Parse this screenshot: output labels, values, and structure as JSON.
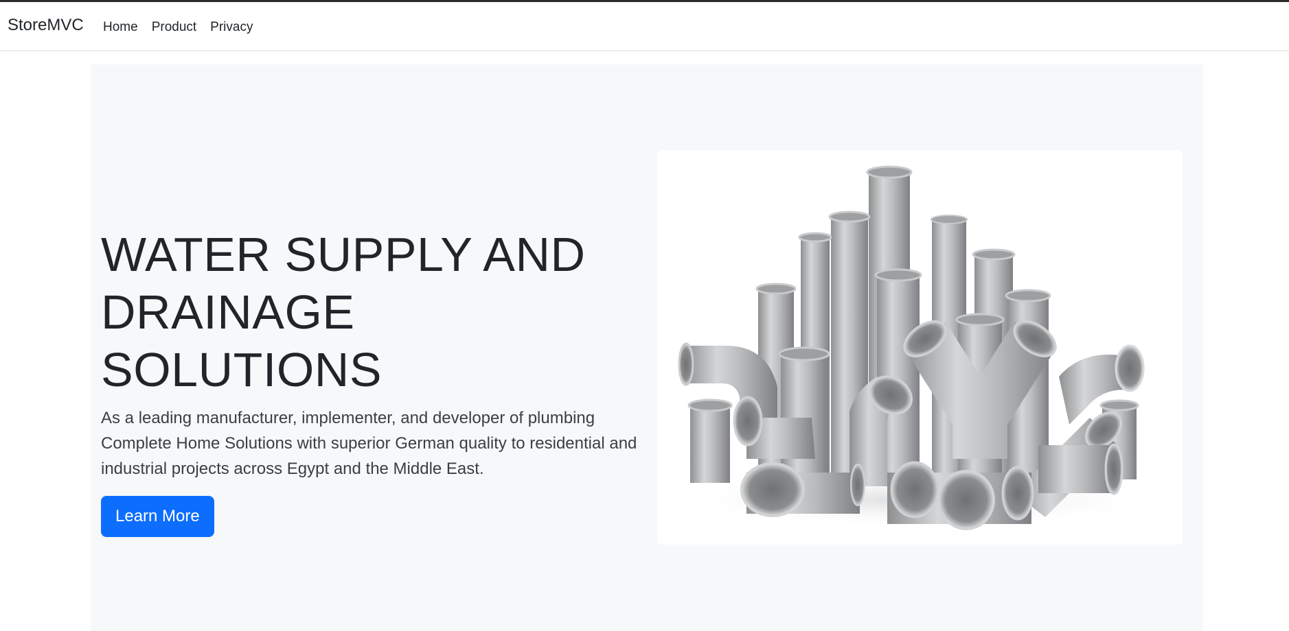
{
  "navbar": {
    "brand": "StoreMVC",
    "links": [
      "Home",
      "Product",
      "Privacy"
    ]
  },
  "hero": {
    "title_line1": "WATER SUPPLY AND",
    "title_line2": "DRAINAGE SOLUTIONS",
    "description": "As a leading manufacturer, implementer, and developer of plumbing Complete Home Solutions with superior German quality to residential and industrial projects across Egypt and the Middle East.",
    "button_label": "Learn More",
    "image_alt": "pipes-image"
  },
  "colors": {
    "accent": "#0d6efd",
    "hero_bg": "#f7f8fa",
    "text": "#212529"
  }
}
